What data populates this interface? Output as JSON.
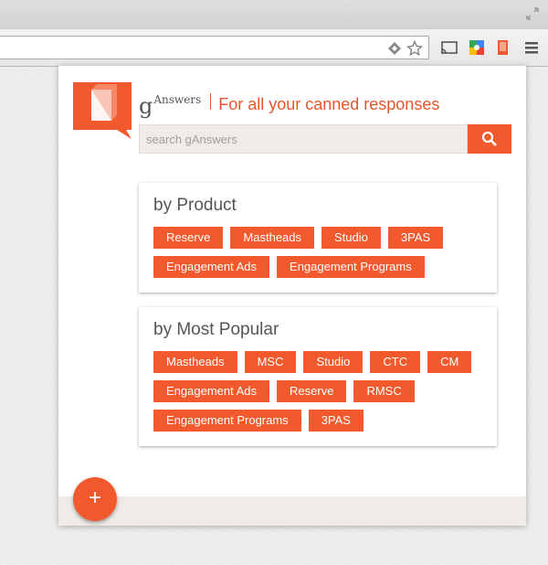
{
  "browser": {
    "icons": [
      "resize-icon",
      "translate-icon",
      "bookmark-star-icon",
      "cast-icon",
      "puzzle-extension-icon",
      "ganswers-extension-icon",
      "menu-icon"
    ]
  },
  "popup": {
    "brand": {
      "g": "g",
      "rest": "Answers"
    },
    "tagline": "For all your canned responses",
    "search": {
      "placeholder": "search gAnswers",
      "value": ""
    },
    "sections": [
      {
        "title": "by Product",
        "tags": [
          "Reserve",
          "Mastheads",
          "Studio",
          "3PAS",
          "Engagement Ads",
          "Engagement Programs"
        ]
      },
      {
        "title": "by Most Popular",
        "tags": [
          "Mastheads",
          "MSC",
          "Studio",
          "CTC",
          "CM",
          "Engagement Ads",
          "Reserve",
          "RMSC",
          "Engagement Programs",
          "3PAS"
        ]
      }
    ],
    "fab_label": "+"
  },
  "colors": {
    "accent": "#f25a2e",
    "text": "#555555",
    "footer": "#efebe9"
  }
}
